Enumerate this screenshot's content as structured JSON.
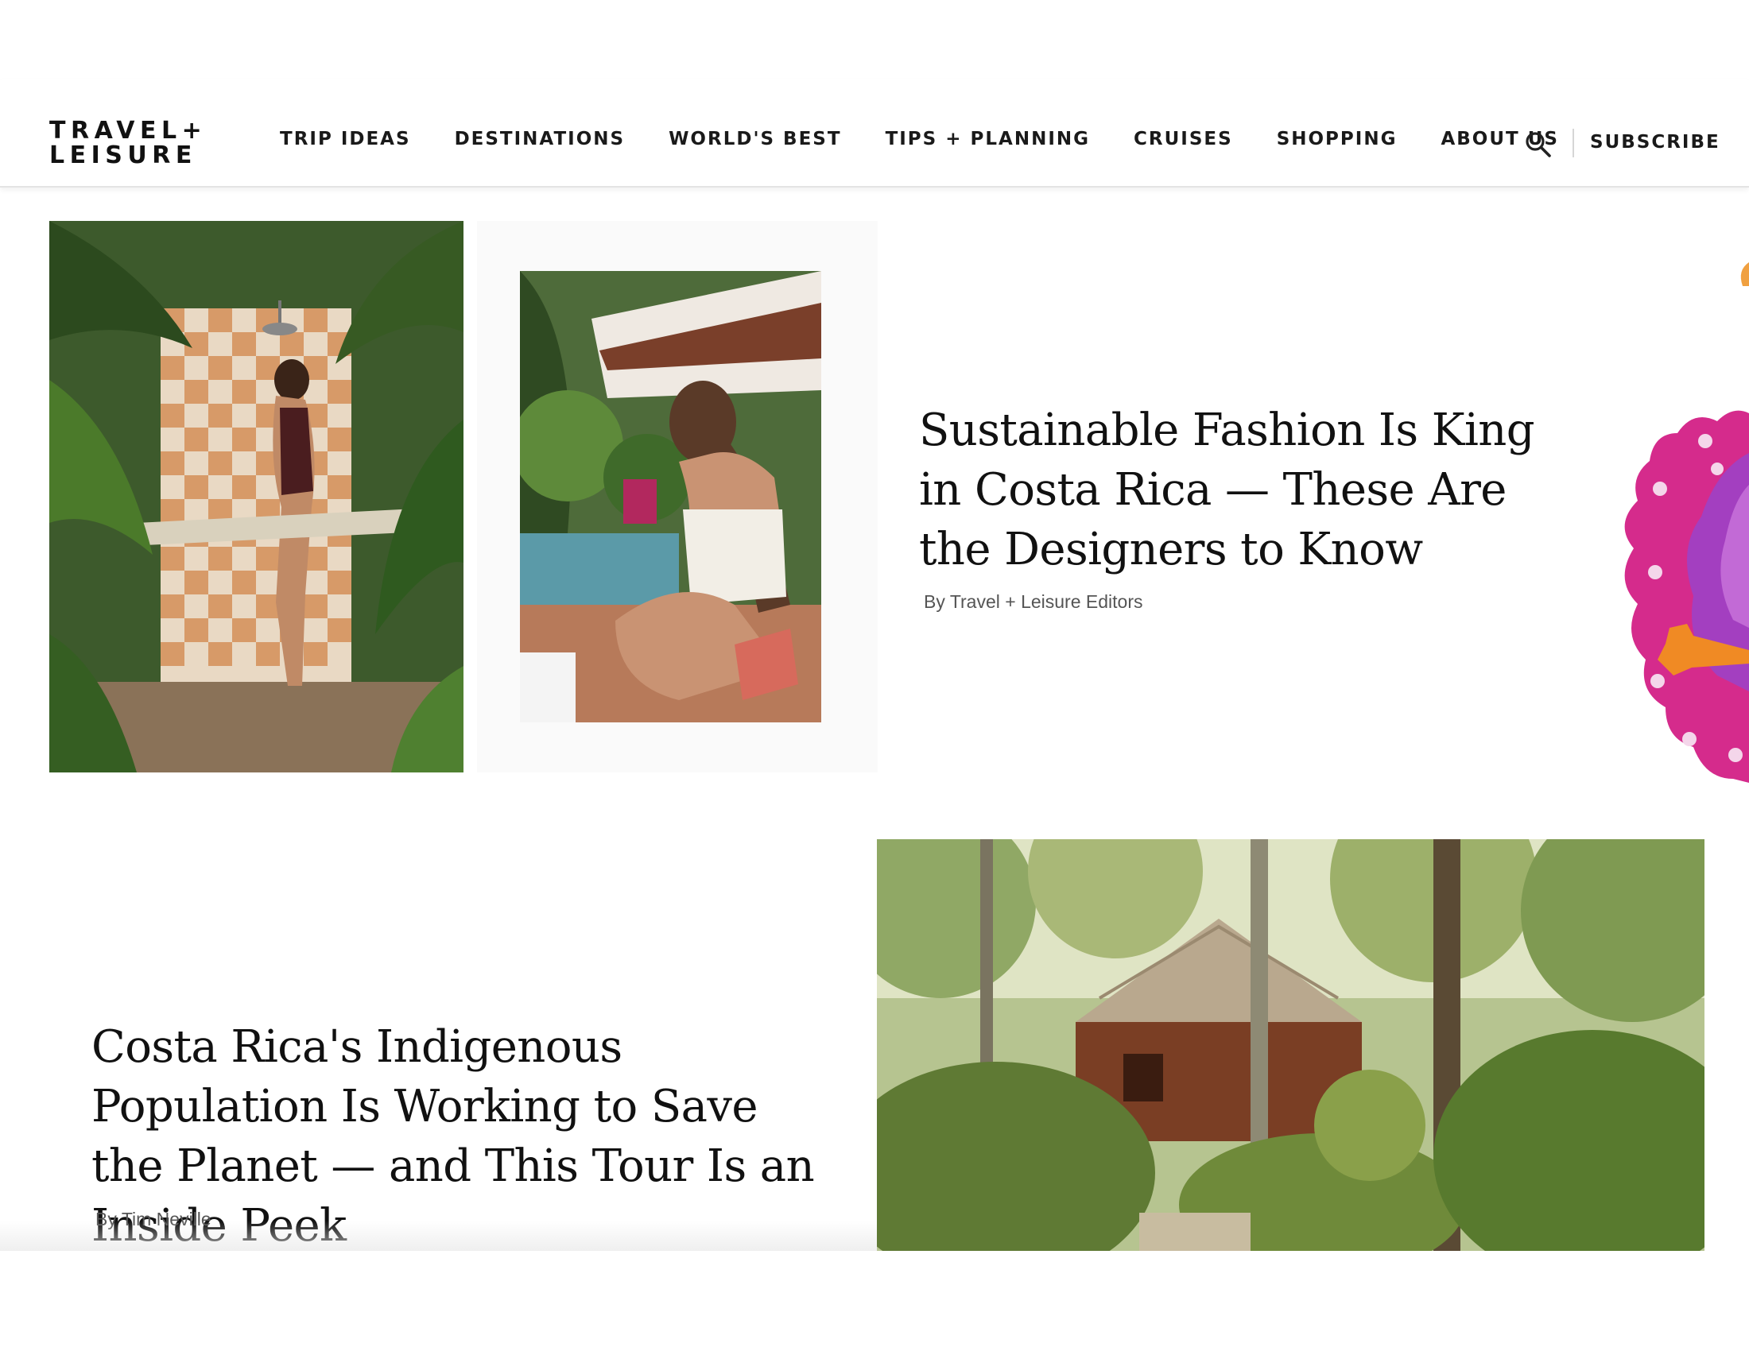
{
  "header": {
    "logo_line1": "TRAVEL+",
    "logo_line2": "LEISURE",
    "nav": [
      "TRIP IDEAS",
      "DESTINATIONS",
      "WORLD'S BEST",
      "TIPS + PLANNING",
      "CRUISES",
      "SHOPPING",
      "ABOUT US"
    ],
    "search_icon": "search-icon",
    "subscribe_label": "SUBSCRIBE"
  },
  "articles": [
    {
      "headline": "Sustainable Fashion Is King in Costa Rica — These Are the Designers to Know",
      "byline": "By Travel + Leisure Editors"
    },
    {
      "headline": "Costa Rica's Indigenous Population Is Working to Save the Planet — and This Tour Is an Inside Peek",
      "byline": "By Tim Neville"
    }
  ],
  "colors": {
    "text": "#111111",
    "byline": "#555555",
    "flower_magenta": "#d52b8c",
    "flower_purple": "#9b3fb8",
    "flower_orange": "#f08a24"
  }
}
